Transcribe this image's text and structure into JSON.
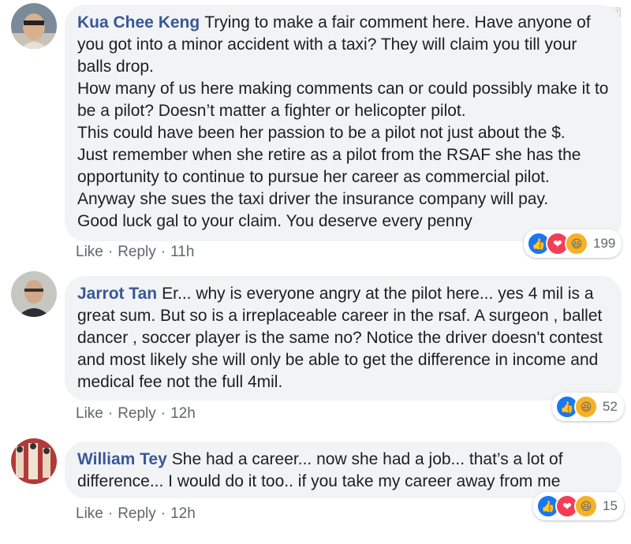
{
  "watermark": "看懂新闻",
  "comments": [
    {
      "author": "Kua Chee Keng",
      "text": "Trying to make a fair comment here. Have anyone of you got into a minor accident with a taxi? They will claim you till your balls drop.\nHow many of us here making comments can or could possibly make it to be a pilot? Doesn’t matter a fighter or helicopter pilot.\nThis could have been her passion to be a pilot not just about the $.\nJust remember when she retire as a pilot from the RSAF she has the opportunity to continue to pursue her career as commercial pilot.\nAnyway she sues the taxi driver the insurance company will pay.\nGood luck gal to your claim. You deserve every penny",
      "like": "Like",
      "reply": "Reply",
      "time": "11h",
      "reaction_count": "199",
      "reactions": [
        "like",
        "love",
        "haha"
      ]
    },
    {
      "author": "Jarrot Tan",
      "text": "Er... why is everyone angry at the pilot here... yes 4 mil is a great sum. But so is a irreplaceable career in the rsaf. A surgeon , ballet dancer , soccer player is the same no? Notice the driver doesn't contest and most likely she will only be able to get the difference in income and medical fee not the full 4mil.",
      "like": "Like",
      "reply": "Reply",
      "time": "12h",
      "reaction_count": "52",
      "reactions": [
        "like",
        "haha"
      ]
    },
    {
      "author": "William Tey",
      "text": "She had a career... now she had a job... that’s a lot of difference... I would do it too.. if you take my career away from me",
      "like": "Like",
      "reply": "Reply",
      "time": "12h",
      "reaction_count": "15",
      "reactions": [
        "like",
        "love",
        "haha"
      ]
    }
  ],
  "colors": {
    "author": "#385898",
    "bubble": "#f2f3f5",
    "like": "#1877f2",
    "love": "#f33e58",
    "haha": "#f7b125"
  }
}
